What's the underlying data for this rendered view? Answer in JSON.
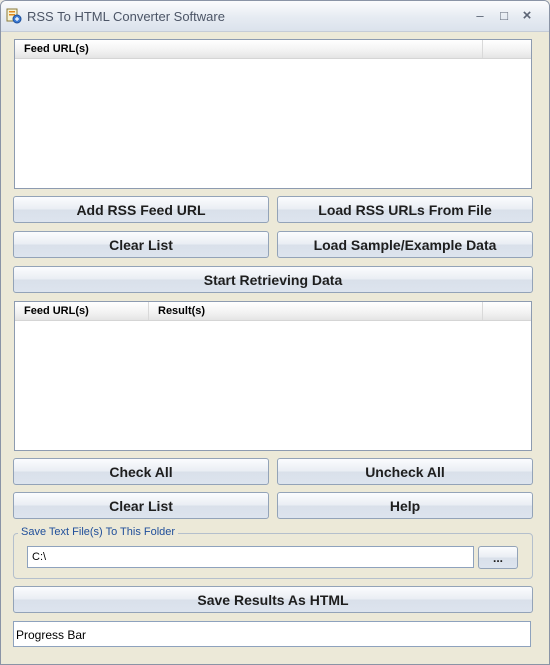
{
  "window": {
    "title": "RSS To HTML Converter Software",
    "minimize_glyph": "–",
    "maximize_glyph": "□",
    "close_glyph": "×"
  },
  "feed_list": {
    "columns": [
      "Feed URL(s)"
    ]
  },
  "buttons": {
    "add_feed": "Add RSS Feed URL",
    "load_from_file": "Load RSS URLs From File",
    "clear_list_top": "Clear List",
    "load_sample": "Load Sample/Example Data",
    "start_retrieving": "Start Retrieving Data",
    "check_all": "Check All",
    "uncheck_all": "Uncheck All",
    "clear_list_bottom": "Clear List",
    "help": "Help",
    "browse": "...",
    "save_results": "Save Results As HTML"
  },
  "results_list": {
    "columns": [
      "Feed URL(s)",
      "Result(s)"
    ]
  },
  "save_folder": {
    "label": "Save Text File(s) To This Folder",
    "value": "C:\\"
  },
  "progress": {
    "label": "Progress Bar"
  },
  "colors": {
    "group_label": "#1f4e9a",
    "window_bg": "#ece9d8"
  }
}
